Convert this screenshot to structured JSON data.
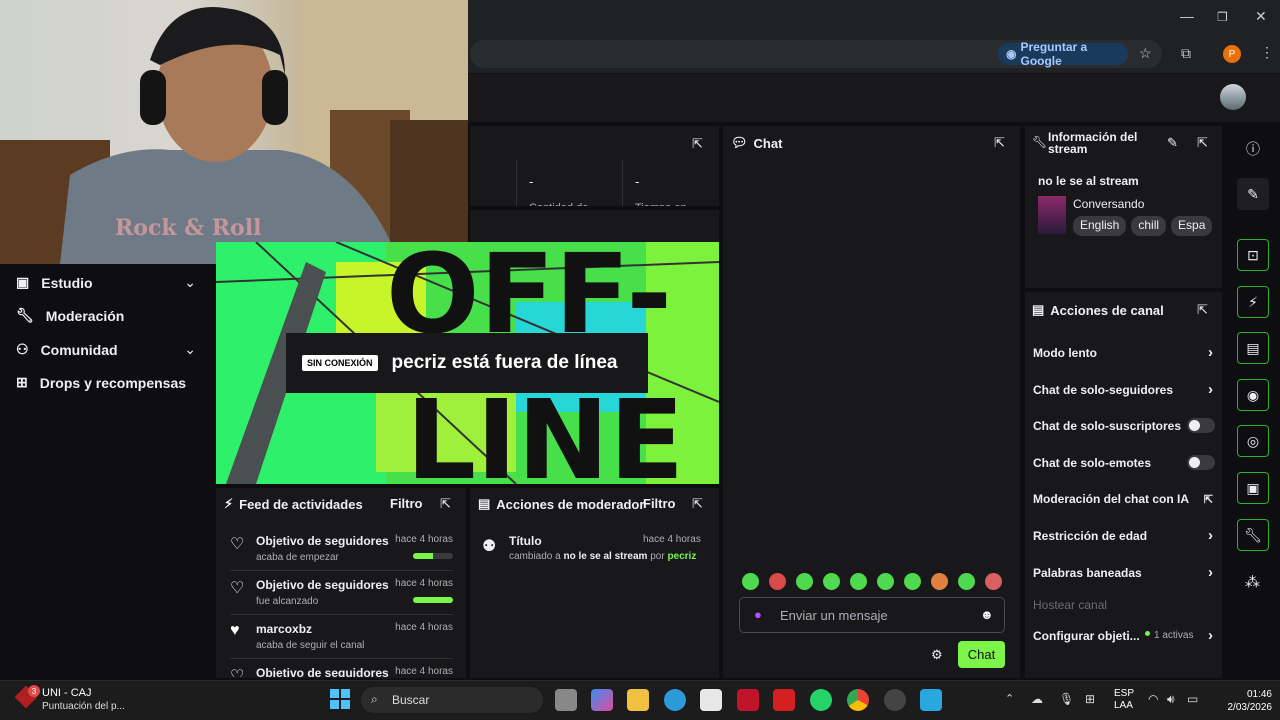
{
  "browser": {
    "ask_google": "Preguntar a Google",
    "profile_initial": "P"
  },
  "nav": {
    "items": [
      {
        "label": "Estudio"
      },
      {
        "label": "Moderación"
      },
      {
        "label": "Comunidad"
      },
      {
        "label": "Drops y recompensas"
      }
    ]
  },
  "stats": {
    "value1": "-",
    "value2": "-",
    "label1": "Cantidad de",
    "label2": "Tiempo en"
  },
  "video": {
    "badge": "SIN CONEXIÓN",
    "message": "pecriz está fuera de línea",
    "bg_text_top": "OFF-",
    "bg_text_bottom": "LINE"
  },
  "feed": {
    "title": "Feed de actividades",
    "filter": "Filtro",
    "items": [
      {
        "title": "Objetivo de seguidores",
        "time": "hace 4 horas",
        "sub": "acaba de empezar",
        "progress": 0.5
      },
      {
        "title": "Objetivo de seguidores",
        "time": "hace 4 horas",
        "sub": "fue alcanzado",
        "progress": 1.0
      },
      {
        "title": "marcoxbz",
        "time": "hace 4 horas",
        "sub": "acaba de seguir el canal"
      },
      {
        "title": "Objetivo de seguidores",
        "time": "hace 4 horas"
      }
    ]
  },
  "mod_actions": {
    "title": "Acciones de moderador",
    "filter": "Filtro",
    "item_title": "Título",
    "item_time": "hace 4 horas",
    "item_changed": "cambiado a",
    "item_value": "no le se al stream",
    "item_by": "por",
    "item_user": "pecriz"
  },
  "chat": {
    "title": "Chat",
    "placeholder": "Enviar un mensaje",
    "send": "Chat"
  },
  "stream_info": {
    "title": "Información del stream",
    "stream_title": "no le se al stream",
    "category": "Conversando",
    "tags": [
      "English",
      "chill",
      "Espa"
    ]
  },
  "channel_actions": {
    "title": "Acciones de canal",
    "rows": [
      {
        "label": "Modo lento",
        "type": "chevron"
      },
      {
        "label": "Chat de solo-seguidores",
        "type": "chevron"
      },
      {
        "label": "Chat de solo-suscriptores",
        "type": "toggle"
      },
      {
        "label": "Chat de solo-emotes",
        "type": "toggle"
      },
      {
        "label": "Moderación del chat con IA",
        "type": "external"
      },
      {
        "label": "Restricción de edad",
        "type": "chevron"
      },
      {
        "label": "Palabras baneadas",
        "type": "chevron"
      }
    ],
    "host": "Hostear canal",
    "configure": "Configurar objeti...",
    "active": "1 activas"
  },
  "taskbar": {
    "notification_count": "3",
    "app_title": "UNI - CAJ",
    "app_sub": "Puntuación del p...",
    "search": "Buscar",
    "lang1": "ESP",
    "lang2": "LAA",
    "time": "01:46",
    "date": "2/03/2026"
  },
  "colors": {
    "accent": "#7cf44a",
    "panel": "#18181b",
    "bg": "#0e0e10"
  }
}
